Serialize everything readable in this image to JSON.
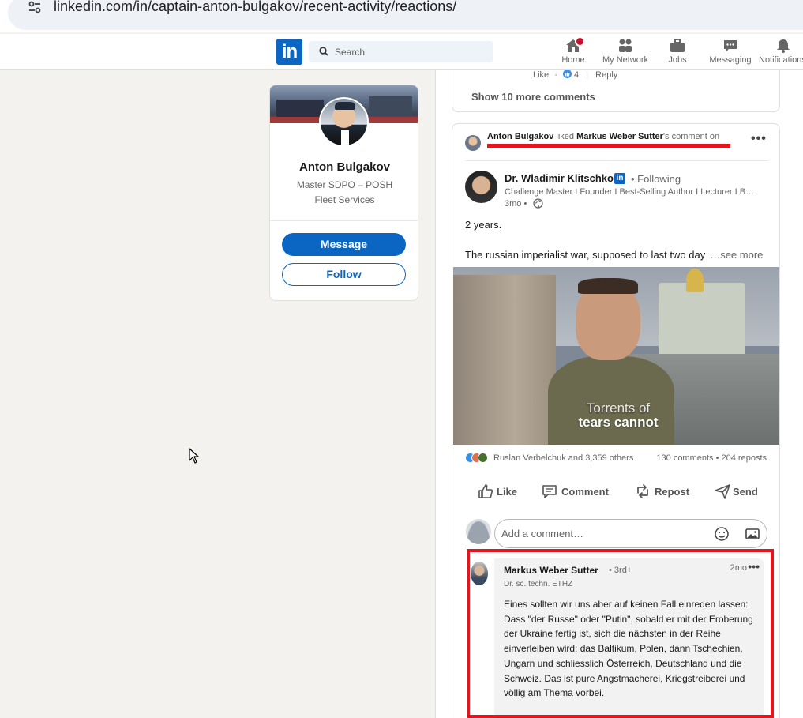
{
  "browser": {
    "url": "linkedin.com/in/captain-anton-bulgakov/recent-activity/reactions/"
  },
  "nav": {
    "logo": "in",
    "search_placeholder": "Search",
    "items": [
      {
        "label": "Home",
        "icon": "home-icon"
      },
      {
        "label": "My Network",
        "icon": "people-icon"
      },
      {
        "label": "Jobs",
        "icon": "briefcase-icon"
      },
      {
        "label": "Messaging",
        "icon": "chat-icon"
      },
      {
        "label": "Notifications",
        "icon": "bell-icon"
      }
    ]
  },
  "profile": {
    "name": "Anton Bulgakov",
    "subtitle_line1": "Master SDPO – POSH",
    "subtitle_line2": "Fleet Services",
    "message_label": "Message",
    "follow_label": "Follow"
  },
  "previous_card": {
    "like_label": "Like",
    "like_count": "4",
    "reply_label": "Reply",
    "show_more": "Show 10 more comments"
  },
  "activity": {
    "actor": "Anton Bulgakov",
    "verb": "liked",
    "target": "Markus Weber Sutter",
    "suffix": "'s comment on",
    "post": {
      "author": "Dr. Wladimir Klitschko",
      "following": "• Following",
      "headline": "Challenge Master I Founder I Best-Selling Author I Lecturer I Business Speaker",
      "time": "3mo •",
      "text_line1": "2 years.",
      "text_line2": "The russian imperialist war, supposed to last two day",
      "see_more": "…see more",
      "video_caption_line1": "Torrents of",
      "video_caption_line2": "tears cannot",
      "reactions_text": "Ruslan Verbelchuk and 3,359 others",
      "counts": "130 comments • 204 reposts",
      "actions": [
        "Like",
        "Comment",
        "Repost",
        "Send"
      ],
      "comment_placeholder": "Add a comment…"
    },
    "comment": {
      "author": "Markus Weber Sutter",
      "degree": "• 3rd+",
      "headline": "Dr. sc. techn. ETHZ",
      "time": "2mo",
      "text": "Eines sollten wir uns aber auf keinen Fall einreden lassen: Dass \"der Russe\" oder \"Putin\", sobald er mit der Eroberung der Ukraine fertig ist, sich die nächsten in der Reihe einverleiben wird: das Baltikum, Polen, dann Tschechien, Ungarn und schliesslich Österreich, Deutschland und die Schweiz. Das ist pure Angstmacherei, Kriegstreiberei und völlig am Thema vorbei."
    }
  },
  "colors": {
    "brand": "#0a66c2",
    "highlight": "#e3151d",
    "notification": "#cb112d"
  }
}
